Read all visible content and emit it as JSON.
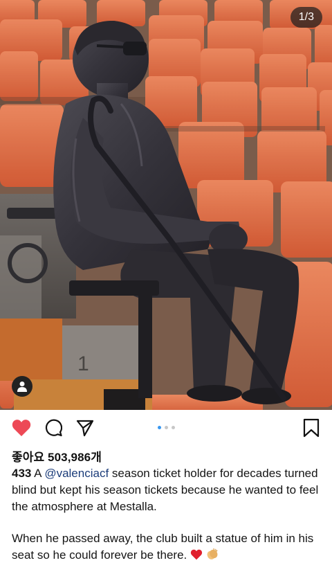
{
  "post": {
    "page_indicator": "1/3",
    "likes_text": "좋아요 503,986개",
    "caption": {
      "username": "433",
      "prefix": "A",
      "mention": "@valenciacf",
      "text_1": "season ticket holder for decades turned blind but kept his season tickets because he wanted to feel the atmosphere at Mestalla.",
      "text_2": "When he passed away, the club built a statue of him in his seat so he could forever be there."
    },
    "carousel": {
      "count": 3,
      "current": 1
    }
  },
  "icons": {
    "like": "heart-filled-icon",
    "comment": "comment-icon",
    "share": "send-icon",
    "save": "bookmark-icon",
    "user_tag": "user-tag-icon"
  },
  "colors": {
    "like_red": "#ed4956",
    "seat_orange": "#e8704a",
    "dot_active": "#3897f0",
    "mention_blue": "#1c3d7a"
  }
}
